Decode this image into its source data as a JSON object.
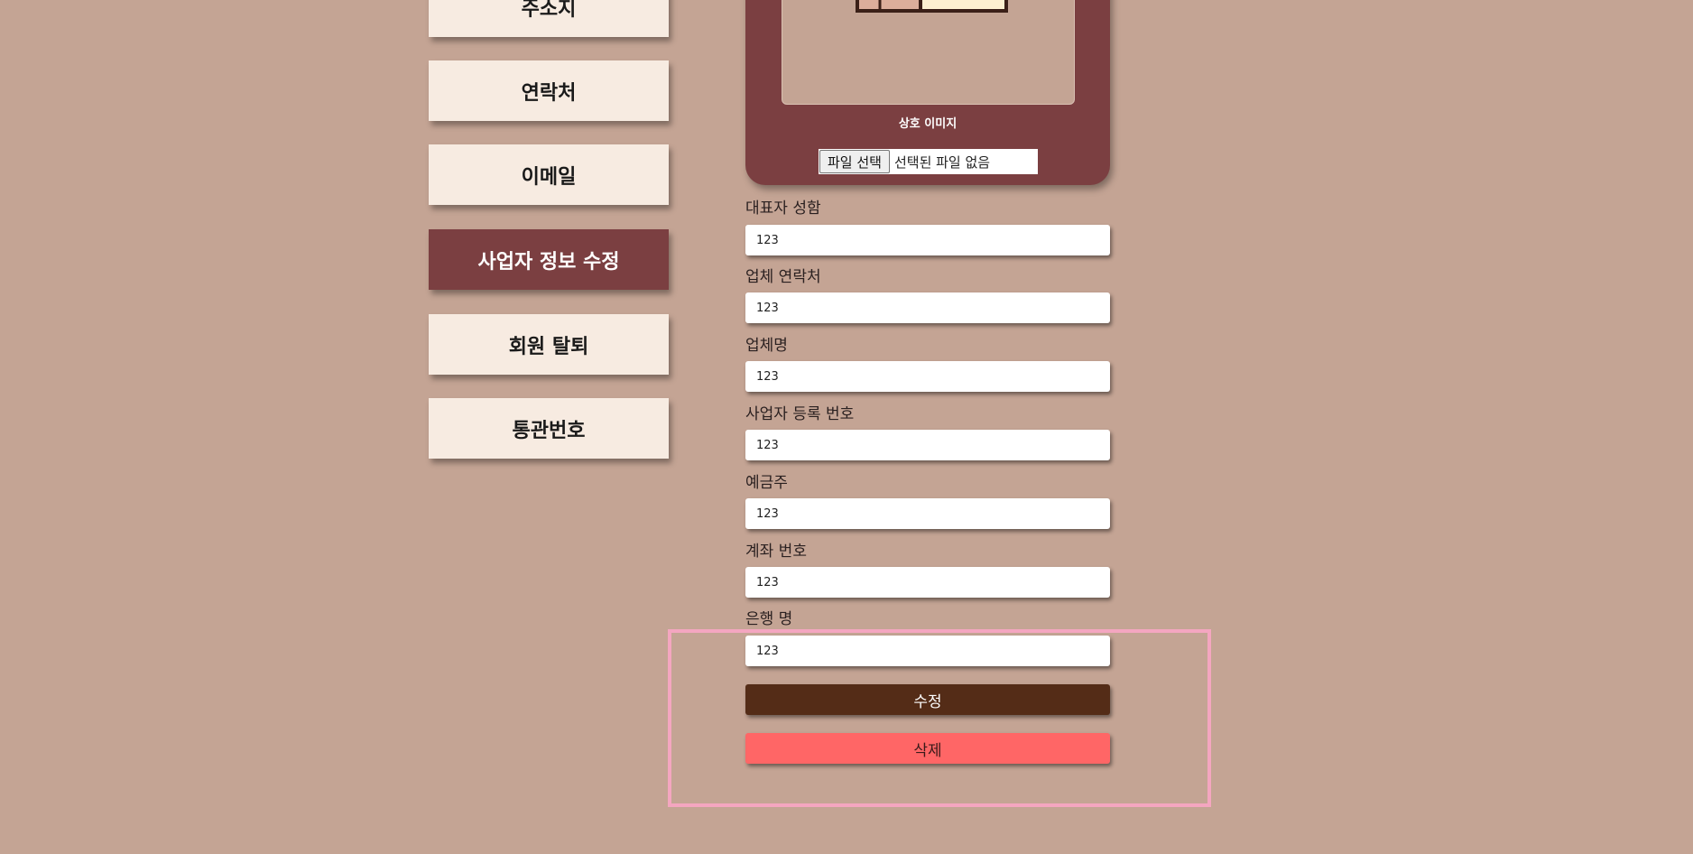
{
  "sidebar": {
    "items": [
      {
        "label": "주소지"
      },
      {
        "label": "연락처"
      },
      {
        "label": "이메일"
      },
      {
        "label": "사업자 정보 수정"
      },
      {
        "label": "회원 탈퇴"
      },
      {
        "label": "통관번호"
      }
    ],
    "active_index": 3
  },
  "image_card": {
    "caption": "상호 이미지",
    "file_button_label": "파일 선택",
    "file_status": "선택된 파일 없음"
  },
  "form": {
    "fields": [
      {
        "label": "대표자 성함",
        "value": "123"
      },
      {
        "label": "업체 연락처",
        "value": "123"
      },
      {
        "label": "업체명",
        "value": "123"
      },
      {
        "label": "사업자 등록 번호",
        "value": "123"
      },
      {
        "label": "예금주",
        "value": "123"
      },
      {
        "label": "계좌 번호",
        "value": "123"
      },
      {
        "label": "은행 명",
        "value": "123"
      }
    ],
    "edit_button": "수정",
    "delete_button": "삭제"
  },
  "colors": {
    "background": "#c4a494",
    "accent": "#7b3f41",
    "sidebar_button": "#f7ebe1",
    "edit_button": "#542c17",
    "delete_button": "#ff6666",
    "highlight": "#f4a6c0"
  }
}
